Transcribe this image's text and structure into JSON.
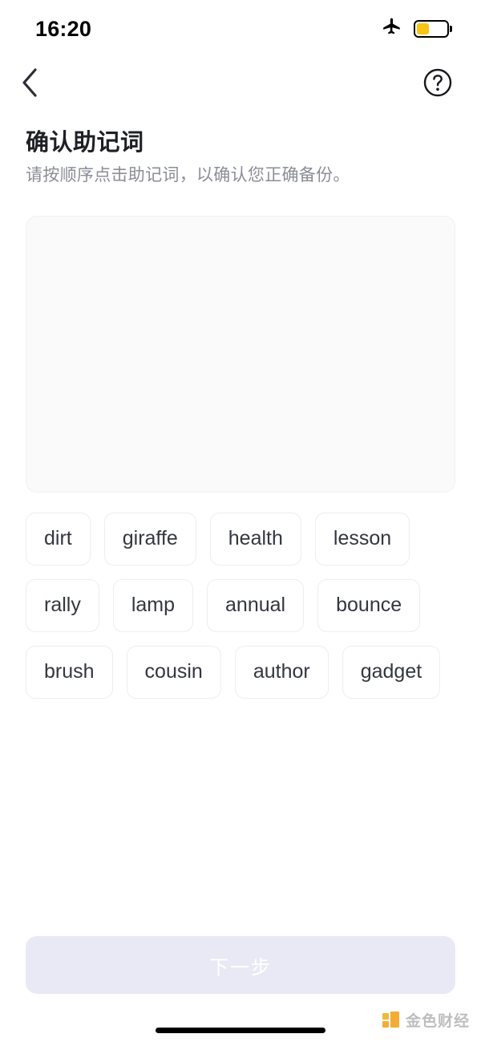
{
  "status_bar": {
    "time": "16:20",
    "airplane_icon": "airplane-mode-icon",
    "battery_icon": "battery-low-power-icon",
    "battery_level_percent": 42,
    "battery_color": "#f9c414"
  },
  "nav": {
    "back_icon": "chevron-left-icon",
    "help_icon": "question-mark-circle-icon"
  },
  "header": {
    "title": "确认助记词",
    "subtitle": "请按顺序点击助记词，以确认您正确备份。"
  },
  "answer_area": {
    "selected_words": [],
    "background_color": "#fafafa",
    "border_color": "#f1f1f3"
  },
  "word_pool": {
    "words": [
      "dirt",
      "giraffe",
      "health",
      "lesson",
      "rally",
      "lamp",
      "annual",
      "bounce",
      "brush",
      "cousin",
      "author",
      "gadget"
    ]
  },
  "footer": {
    "next_label": "下一步",
    "next_enabled": false,
    "next_background": "#e9e9f5",
    "next_text_color": "#ffffff"
  },
  "watermark": {
    "text": "金色财经",
    "logo_color": "#f5a623"
  },
  "home_indicator": {
    "visible": true
  }
}
